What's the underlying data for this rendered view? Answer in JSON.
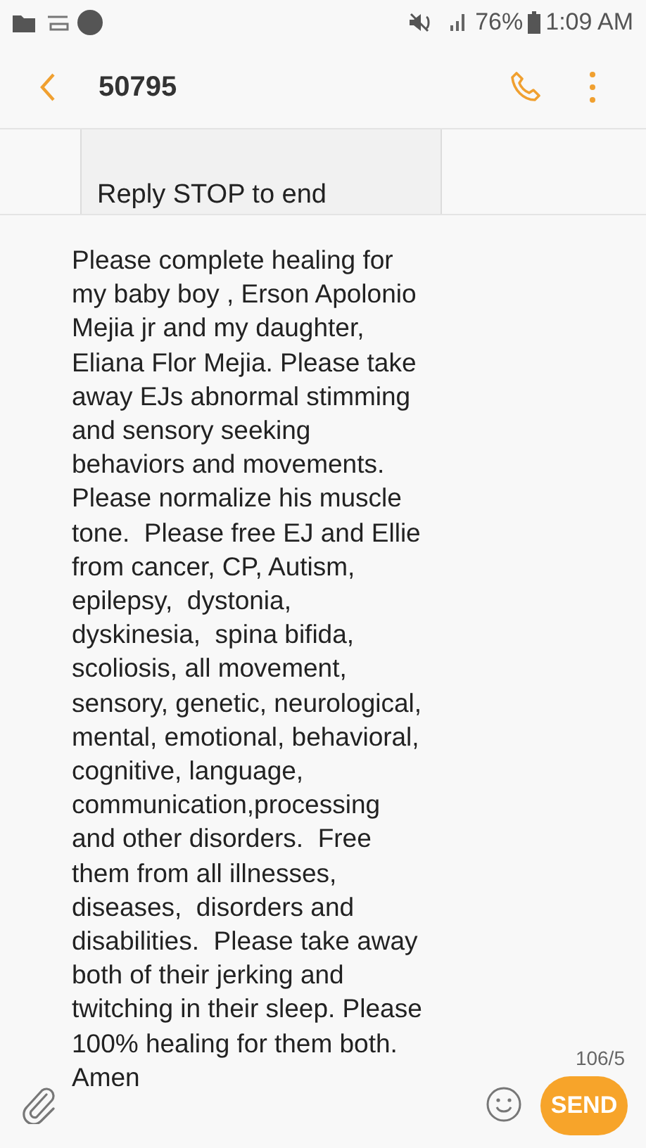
{
  "status_bar": {
    "battery": "76%",
    "time": "1:09 AM"
  },
  "header": {
    "title": "50795"
  },
  "previous_message": {
    "text": "Reply STOP to end"
  },
  "composer": {
    "value": "Please complete healing for\nmy baby boy , Erson Apolonio\nMejia jr and my daughter,\nEliana Flor Mejia. Please take\naway EJs abnormal stimming\nand sensory seeking\nbehaviors and movements.\nPlease normalize his muscle\ntone.  Please free EJ and Ellie\nfrom cancer, CP, Autism,\nepilepsy,  dystonia,\ndyskinesia,  spina bifida,\nscoliosis, all movement,\nsensory, genetic, neurological,\nmental, emotional, behavioral,\ncognitive, language,\ncommunication,processing\nand other disorders.  Free\nthem from all illnesses,\ndiseases,  disorders and\ndisabilities.  Please take away\nboth of their jerking and\ntwitching in their sleep. Please\n100% healing for them both.\nAmen",
    "counter": "106/5",
    "send_label": "SEND"
  }
}
